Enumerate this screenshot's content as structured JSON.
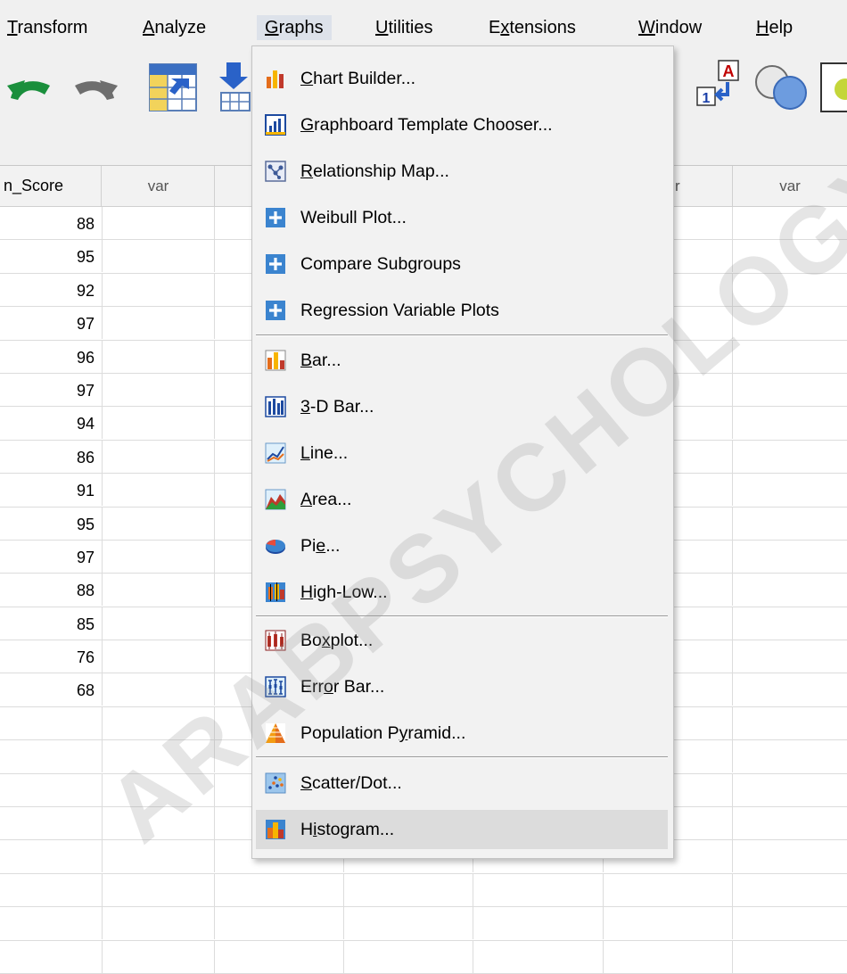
{
  "menubar": {
    "items": [
      {
        "label": "Transform",
        "mnemonic": "T"
      },
      {
        "label": "Analyze",
        "mnemonic": "A"
      },
      {
        "label": "Graphs",
        "mnemonic": "G"
      },
      {
        "label": "Utilities",
        "mnemonic": "U"
      },
      {
        "label": "Extensions",
        "mnemonic": "x"
      },
      {
        "label": "Window",
        "mnemonic": "W"
      },
      {
        "label": "Help",
        "mnemonic": "H"
      }
    ]
  },
  "toolbar": {
    "icons": [
      "undo-icon",
      "redo-icon",
      "go-to-case-icon",
      "go-to-variable-icon",
      "value-labels-icon",
      "use-sets-icon"
    ],
    "value_labels_text": {
      "top": "A",
      "bottom": "1"
    }
  },
  "grid": {
    "headers": [
      "n_Score",
      "var",
      "",
      "",
      "r",
      "var"
    ],
    "values": [
      "88",
      "95",
      "92",
      "97",
      "96",
      "97",
      "94",
      "86",
      "91",
      "95",
      "97",
      "88",
      "85",
      "76",
      "68",
      "",
      "",
      "",
      "",
      "",
      "",
      "",
      ""
    ]
  },
  "graphs_menu": {
    "items": [
      {
        "label": "Chart Builder...",
        "mnemonic": "C",
        "icon": "chart-builder-icon"
      },
      {
        "label": "Graphboard Template Chooser...",
        "mnemonic": "G",
        "icon": "graphboard-icon"
      },
      {
        "label": "Relationship Map...",
        "mnemonic": "R",
        "icon": "relationship-map-icon"
      },
      {
        "label": "Weibull Plot...",
        "mnemonic": "",
        "icon": "plus-icon"
      },
      {
        "label": "Compare Subgroups",
        "mnemonic": "",
        "icon": "plus-icon"
      },
      {
        "label": "Regression Variable Plots",
        "mnemonic": "",
        "icon": "plus-icon"
      },
      {
        "label": "Bar...",
        "mnemonic": "B",
        "icon": "bar-chart-icon"
      },
      {
        "label": "3-D Bar...",
        "mnemonic": "3",
        "icon": "3d-bar-icon"
      },
      {
        "label": "Line...",
        "mnemonic": "L",
        "icon": "line-chart-icon"
      },
      {
        "label": "Area...",
        "mnemonic": "A",
        "icon": "area-chart-icon"
      },
      {
        "label": "Pie...",
        "mnemonic": "e",
        "icon": "pie-chart-icon"
      },
      {
        "label": "High-Low...",
        "mnemonic": "H",
        "icon": "high-low-icon"
      },
      {
        "label": "Boxplot...",
        "mnemonic": "x",
        "icon": "boxplot-icon"
      },
      {
        "label": "Error Bar...",
        "mnemonic": "o",
        "icon": "error-bar-icon"
      },
      {
        "label": "Population Pyramid...",
        "mnemonic": "y",
        "icon": "population-pyramid-icon"
      },
      {
        "label": "Scatter/Dot...",
        "mnemonic": "S",
        "icon": "scatter-icon"
      },
      {
        "label": "Histogram...",
        "mnemonic": "i",
        "icon": "histogram-icon"
      }
    ],
    "highlighted": "Histogram..."
  },
  "watermark": "ARABPSYCHOLOGY"
}
